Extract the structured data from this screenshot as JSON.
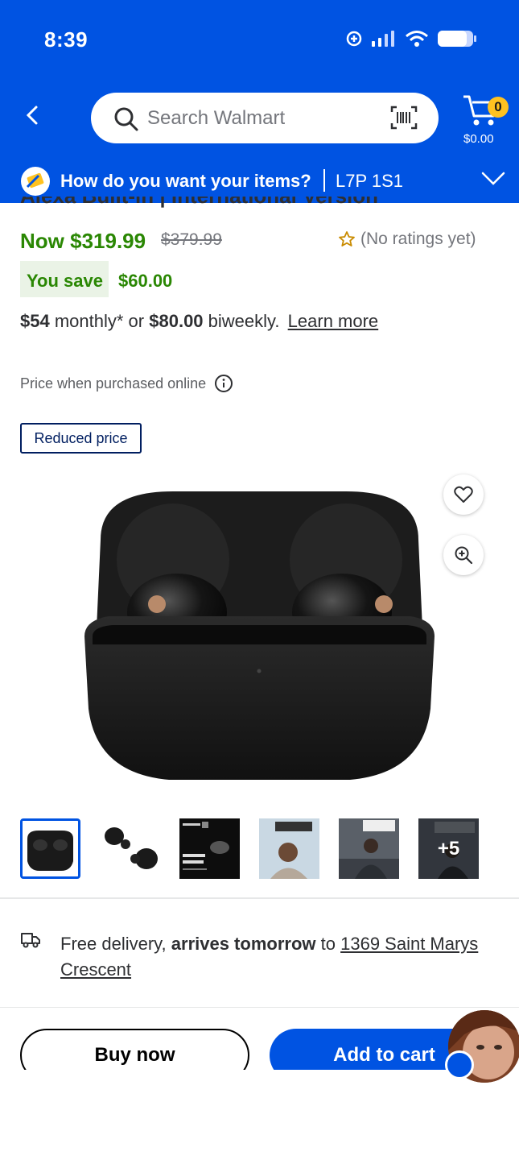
{
  "status_bar": {
    "time": "8:39"
  },
  "header": {
    "search_placeholder": "Search Walmart",
    "cart_count": "0",
    "cart_amount": "$0.00"
  },
  "delivery_bar": {
    "question": "How do you want your items?",
    "postal_code": "L7P 1S1"
  },
  "product": {
    "title_fragment": "Alexa Built-in | International Version",
    "now_price": "Now $319.99",
    "was_price": "$379.99",
    "ratings": "(No ratings yet)",
    "you_save_label": "You save",
    "you_save_amount": "$60.00",
    "monthly_amount": "$54",
    "monthly_text": "monthly* or",
    "biweekly_amount": "$80.00",
    "biweekly_text": "biweekly.",
    "learn_more": "Learn more",
    "price_note": "Price when purchased online",
    "badge": "Reduced price",
    "more_images": "+5"
  },
  "shipping": {
    "prefix": "Free delivery,",
    "bold": "arrives tomorrow",
    "to": "to",
    "address": "1369 Saint Marys Crescent"
  },
  "actions": {
    "buy_now": "Buy now",
    "add_to_cart": "Add to cart"
  },
  "colors": {
    "brand_blue": "#0053e2",
    "price_green": "#2a8703",
    "spark_yellow": "#ffc220"
  }
}
